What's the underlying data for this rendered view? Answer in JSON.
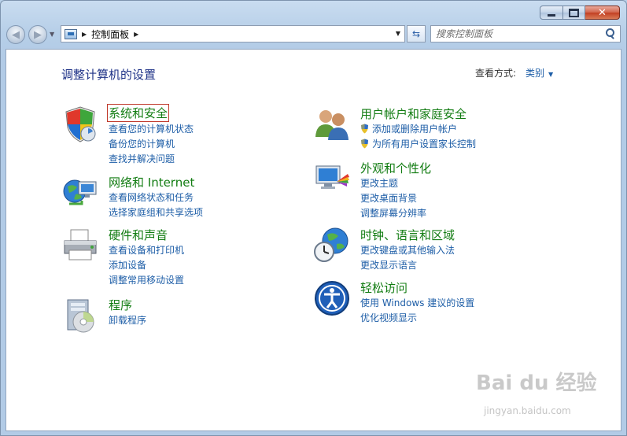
{
  "window": {
    "close_glyph": "✕"
  },
  "navbar": {
    "back_glyph": "◀",
    "forward_glyph": "▶",
    "address_path": "控制面板",
    "refresh_glyph": "⇆",
    "search_placeholder": "搜索控制面板"
  },
  "header": {
    "title": "调整计算机的设置",
    "view_by_label": "查看方式:",
    "view_by_value": "类别"
  },
  "categories": [
    {
      "title": "系统和安全",
      "icon": "shield-icon",
      "links": [
        "查看您的计算机状态",
        "备份您的计算机",
        "查找并解决问题"
      ]
    },
    {
      "title": "网络和 Internet",
      "icon": "network-globe-icon",
      "links": [
        "查看网络状态和任务",
        "选择家庭组和共享选项"
      ]
    },
    {
      "title": "硬件和声音",
      "icon": "printer-icon",
      "links": [
        "查看设备和打印机",
        "添加设备",
        "调整常用移动设置"
      ]
    },
    {
      "title": "程序",
      "icon": "programs-disc-icon",
      "links": [
        "卸载程序"
      ]
    },
    {
      "title": "用户帐户和家庭安全",
      "icon": "users-icon",
      "links": [
        "添加或删除用户帐户",
        "为所有用户设置家长控制"
      ]
    },
    {
      "title": "外观和个性化",
      "icon": "display-palette-icon",
      "links": [
        "更改主题",
        "更改桌面背景",
        "调整屏幕分辨率"
      ]
    },
    {
      "title": "时钟、语言和区域",
      "icon": "clock-globe-icon",
      "links": [
        "更改键盘或其他输入法",
        "更改显示语言"
      ]
    },
    {
      "title": "轻松访问",
      "icon": "ease-of-access-icon",
      "links": [
        "使用 Windows 建议的设置",
        "优化视频显示"
      ]
    }
  ],
  "watermark": {
    "brand": "Bai du 经验",
    "url": "jingyan.baidu.com"
  },
  "colors": {
    "link": "#1e5ea7",
    "category_title": "#127c12",
    "page_title": "#1e3287",
    "highlight_box": "#c0392b"
  }
}
